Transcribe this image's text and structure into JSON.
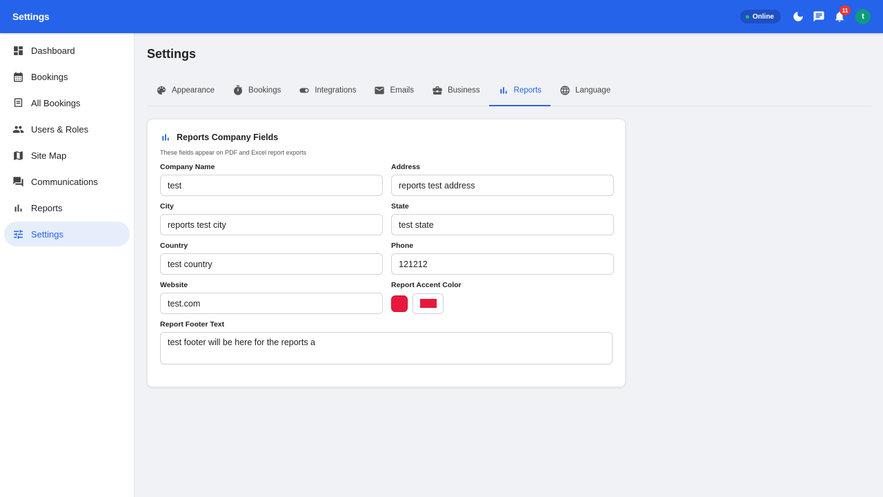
{
  "app": {
    "title": "Settings"
  },
  "appbar": {
    "status_label": "Online",
    "notification_count": "11",
    "avatar_initial": "t"
  },
  "sidebar": {
    "items": [
      {
        "label": "Dashboard",
        "icon": "dashboard-icon"
      },
      {
        "label": "Bookings",
        "icon": "calendar-icon"
      },
      {
        "label": "All Bookings",
        "icon": "receipt-icon"
      },
      {
        "label": "Users & Roles",
        "icon": "people-icon"
      },
      {
        "label": "Site Map",
        "icon": "map-icon"
      },
      {
        "label": "Communications",
        "icon": "forum-icon"
      },
      {
        "label": "Reports",
        "icon": "bar-chart-icon"
      },
      {
        "label": "Settings",
        "icon": "tune-icon",
        "active": true
      }
    ]
  },
  "page": {
    "title": "Settings"
  },
  "tabs": [
    {
      "label": "Appearance",
      "icon": "palette-icon"
    },
    {
      "label": "Bookings",
      "icon": "timer-icon"
    },
    {
      "label": "Integrations",
      "icon": "toggle-icon"
    },
    {
      "label": "Emails",
      "icon": "mail-icon"
    },
    {
      "label": "Business",
      "icon": "briefcase-icon"
    },
    {
      "label": "Reports",
      "icon": "bar-chart-icon",
      "active": true
    },
    {
      "label": "Language",
      "icon": "globe-icon"
    }
  ],
  "card": {
    "title": "Reports Company Fields",
    "subtitle": "These fields appear on PDF and Excel report exports",
    "fields": {
      "company_name": {
        "label": "Company Name",
        "value": "test"
      },
      "address": {
        "label": "Address",
        "value": "reports test address"
      },
      "city": {
        "label": "City",
        "value": "reports test city"
      },
      "state": {
        "label": "State",
        "value": "test state"
      },
      "country": {
        "label": "Country",
        "value": "test country"
      },
      "phone": {
        "label": "Phone",
        "value": "121212"
      },
      "website": {
        "label": "Website",
        "value": "test.com"
      },
      "accent_color": {
        "label": "Report Accent Color",
        "value": "#e8183d"
      },
      "footer_text": {
        "label": "Report Footer Text",
        "value": "test footer will be here for the reports a"
      }
    }
  },
  "colors": {
    "primary": "#2563eb",
    "accent": "#e8183d",
    "online": "#22c55e",
    "badge": "#e53935",
    "avatar": "#0f9b7a"
  }
}
